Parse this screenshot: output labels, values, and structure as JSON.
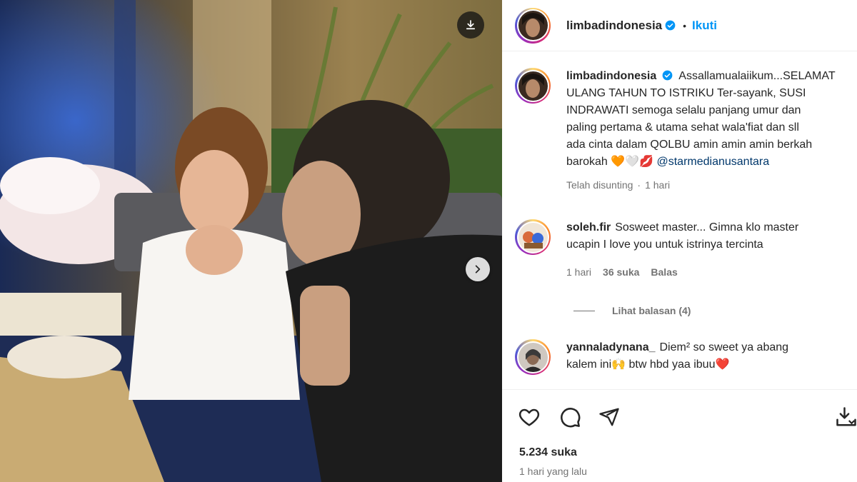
{
  "post": {
    "username": "limbadindonesia",
    "follow_label": "Ikuti",
    "separator": "•",
    "caption": {
      "username": "limbadindonesia",
      "text_lines": [
        "Assallamualaiikum...SELAMAT",
        "ULANG TAHUN TO ISTRIKU Ter-sayank, SUSI",
        "INDRAWATI semoga selalu panjang umur dan",
        "paling pertama & utama sehat wala'fiat dan sll",
        "ada cinta dalam QOLBU amin amin amin berkah",
        "barokah 🧡🤍💋"
      ],
      "mention": "@starmedianusantara",
      "edited_label": "Telah disunting",
      "edited_time": "1 hari"
    },
    "comments": [
      {
        "username": "soleh.fir",
        "text_lines": [
          "Sosweet master... Gimna klo master",
          "ucapin I love you untuk istrinya tercinta"
        ],
        "time": "1 hari",
        "likes": "36 suka",
        "reply_label": "Balas",
        "view_replies": "Lihat balasan (4)"
      },
      {
        "username": "yannaladynana_",
        "text_lines": [
          "Diem² so sweet ya abang",
          "kalem ini🙌 btw hbd yaa ibuu❤️"
        ]
      }
    ],
    "likes_count": "5.234 suka",
    "posted_time": "1 hari yang lalu"
  },
  "icons": {
    "download": "download-icon",
    "next": "chevron-right-icon",
    "like": "heart-icon",
    "comment": "comment-icon",
    "share": "send-icon",
    "save": "save-download-icon",
    "verified": "verified-badge-icon"
  },
  "colors": {
    "accent": "#0095f6",
    "verified": "#0095f6",
    "text": "#262626",
    "muted": "#737373",
    "mention": "#00376b"
  }
}
